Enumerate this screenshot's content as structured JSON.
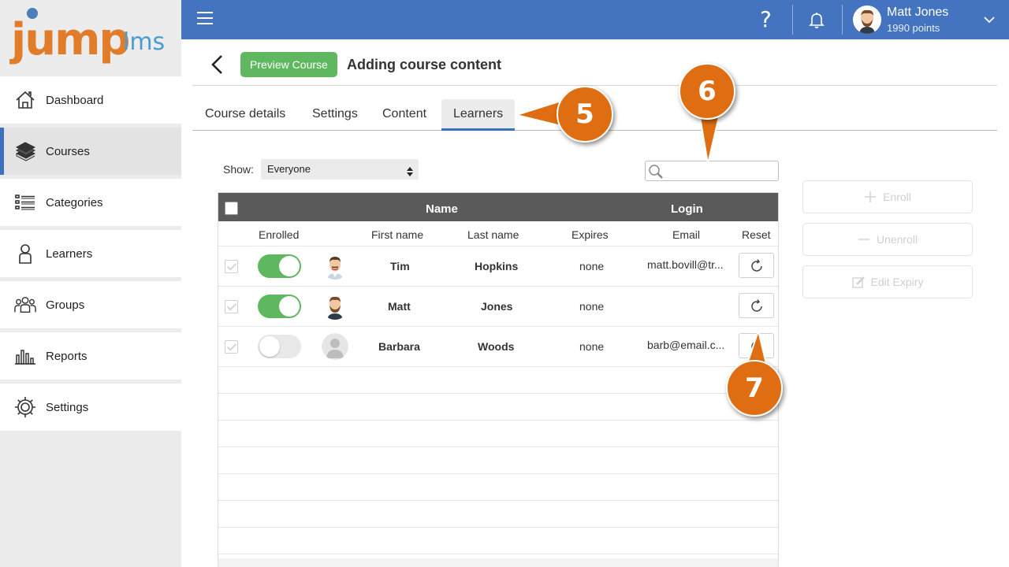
{
  "app": {
    "logo_main": "jump",
    "logo_sub": "lms"
  },
  "sidebar": {
    "items": [
      {
        "label": "Dashboard",
        "icon": "house-icon"
      },
      {
        "label": "Courses",
        "icon": "books-icon",
        "active": true
      },
      {
        "label": "Categories",
        "icon": "list-icon"
      },
      {
        "label": "Learners",
        "icon": "person-icon"
      },
      {
        "label": "Groups",
        "icon": "group-icon"
      },
      {
        "label": "Reports",
        "icon": "bar-chart-icon"
      },
      {
        "label": "Settings",
        "icon": "gear-icon"
      }
    ]
  },
  "topbar": {
    "help": "?",
    "user_name": "Matt Jones",
    "user_points": "1990 points"
  },
  "page": {
    "preview_button": "Preview Course",
    "title": "Adding course content"
  },
  "tabs": [
    {
      "label": "Course details"
    },
    {
      "label": "Settings"
    },
    {
      "label": "Content"
    },
    {
      "label": "Learners",
      "active": true
    }
  ],
  "filter": {
    "show_label": "Show:",
    "show_value": "Everyone",
    "search_placeholder": ""
  },
  "table": {
    "group_headers": {
      "name": "Name",
      "login": "Login"
    },
    "columns": {
      "enrolled": "Enrolled",
      "first_name": "First name",
      "last_name": "Last name",
      "expires": "Expires",
      "email": "Email",
      "reset": "Reset"
    },
    "rows": [
      {
        "first": "Tim",
        "last": "Hopkins",
        "expires": "none",
        "email": "matt.bovill@tr...",
        "enrolled": true
      },
      {
        "first": "Matt",
        "last": "Jones",
        "expires": "none",
        "email": "",
        "enrolled": true
      },
      {
        "first": "Barbara",
        "last": "Woods",
        "expires": "none",
        "email": "barb@email.c...",
        "enrolled": false
      }
    ]
  },
  "actions": {
    "enroll": "Enroll",
    "unenroll": "Unenroll",
    "edit_expiry": "Edit Expiry"
  },
  "callouts": {
    "c5": "5",
    "c6": "6",
    "c7": "7"
  },
  "colors": {
    "topbar": "#4474c0",
    "accent_green": "#5fb85f",
    "callout_orange": "#df6e12",
    "active_tab_underline": "#3f6fbf"
  }
}
